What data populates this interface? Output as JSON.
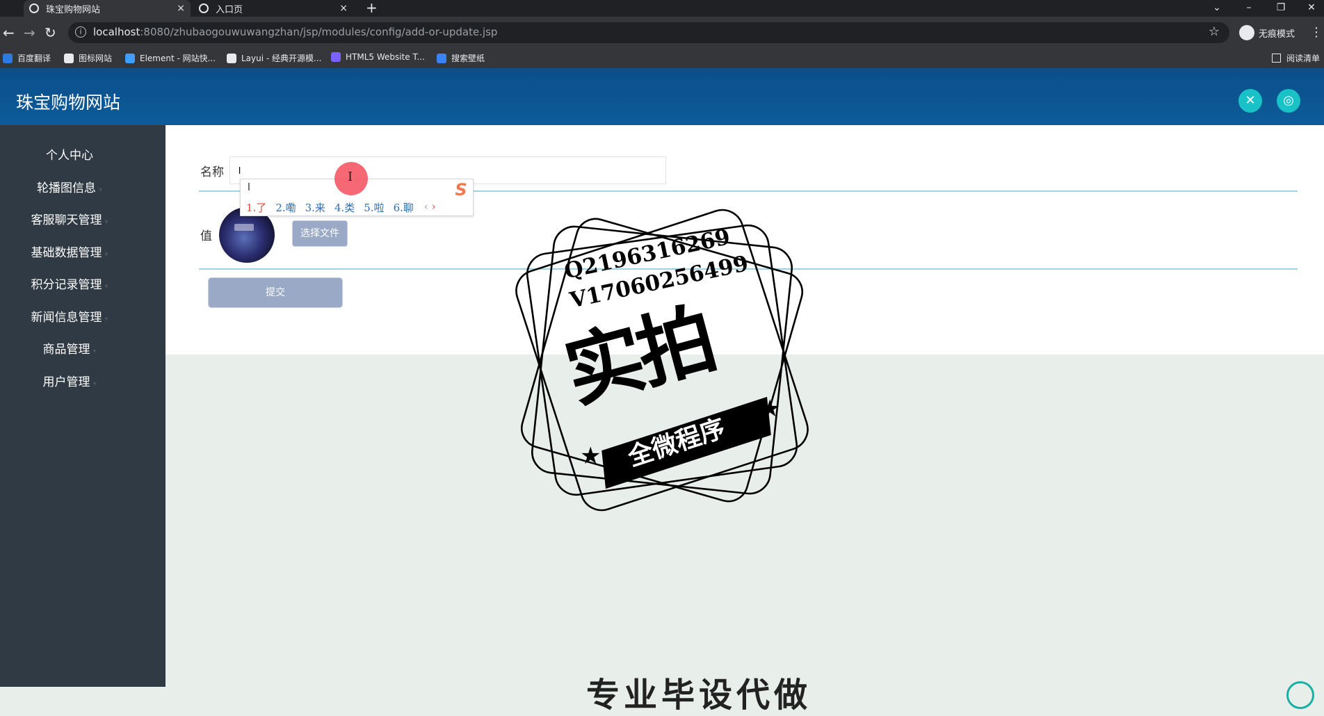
{
  "browser": {
    "tabs": [
      {
        "title": "珠宝购物网站",
        "close": "×",
        "active": true
      },
      {
        "title": "入口页",
        "close": "×",
        "active": false
      }
    ],
    "new_tab": "+",
    "window_controls": {
      "dropdown": "⌄",
      "minimize": "–",
      "restore": "❐",
      "close": "✕"
    },
    "nav": {
      "back": "←",
      "forward": "→",
      "reload": "↻"
    },
    "url_host": "localhost",
    "url_rest": ":8080/zhubaogouwuwangzhan/jsp/modules/config/add-or-update.jsp",
    "bookmark_star": "☆",
    "incognito_label": "无痕模式",
    "menu_dots": "⋮",
    "bookmarks": [
      {
        "label": "百度翻译",
        "color": "#2d7ae0"
      },
      {
        "label": "图标网站",
        "color": "#e8eaed"
      },
      {
        "label": "Element - 网站快...",
        "color": "#409eff"
      },
      {
        "label": "Layui - 经典开源模...",
        "color": "#e8eaed"
      },
      {
        "label": "HTML5 Website T...",
        "color": "#7b61ff"
      },
      {
        "label": "搜索壁纸",
        "color": "#3b82f6"
      }
    ],
    "reading_list": "阅读清单"
  },
  "app": {
    "title": "珠宝购物网站",
    "header_icons": [
      "expand-icon",
      "user-icon"
    ],
    "accent": "#0c5b98",
    "button_accent": "#19c2c7",
    "sidebar": {
      "items": [
        {
          "label": "个人中心",
          "arrow": false
        },
        {
          "label": "轮播图信息",
          "arrow": true
        },
        {
          "label": "客服聊天管理",
          "arrow": true
        },
        {
          "label": "基础数据管理",
          "arrow": true
        },
        {
          "label": "积分记录管理",
          "arrow": true
        },
        {
          "label": "新闻信息管理",
          "arrow": true
        },
        {
          "label": "商品管理",
          "arrow": true
        },
        {
          "label": "用户管理",
          "arrow": true
        }
      ],
      "arrow_glyph": "▾"
    },
    "form": {
      "name_label": "名称",
      "name_value": "l",
      "value_label": "值",
      "file_button": "选择文件",
      "submit_button": "提交"
    },
    "ime": {
      "composition": "l",
      "logo": "S",
      "candidates": [
        "1.了",
        "2.嘞",
        "3.来",
        "4.类",
        "5.啦",
        "6.聊"
      ],
      "prev": "‹",
      "next": "›"
    },
    "cursor_glyph": "I"
  },
  "watermark": {
    "contact_1": "Q2196316269",
    "contact_2": "V17060256499",
    "main": "实拍",
    "band": "全微程序",
    "star": "★",
    "bottom_text": "专业毕设代做"
  }
}
